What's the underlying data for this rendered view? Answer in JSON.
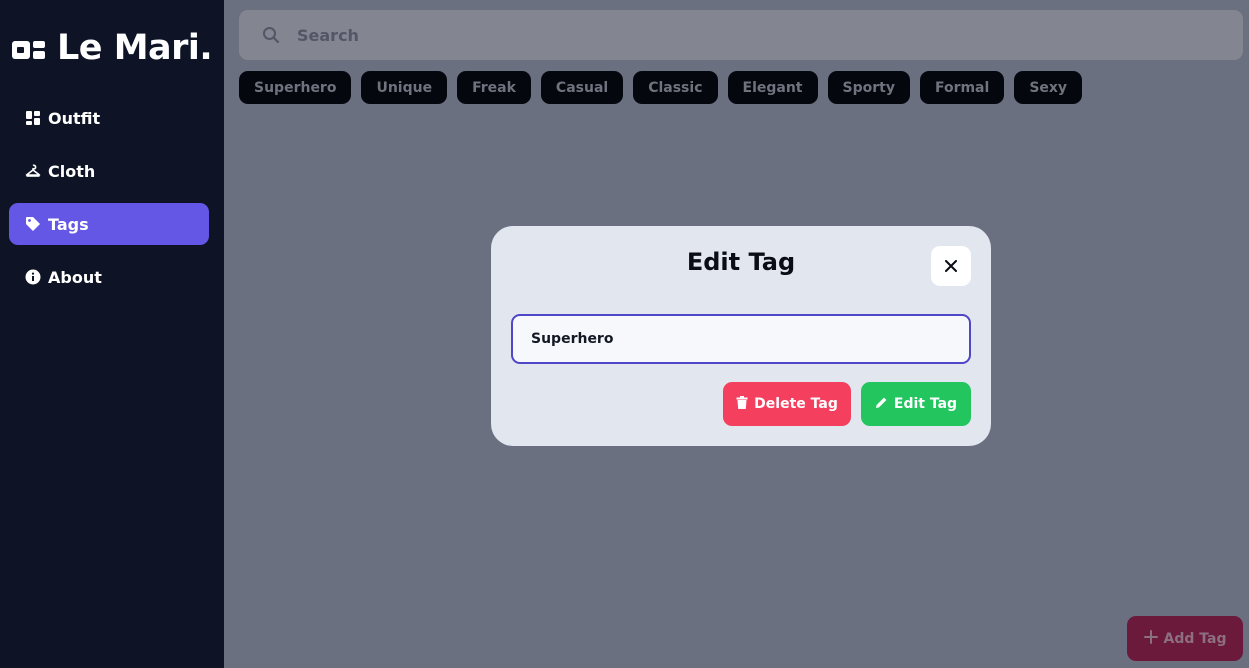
{
  "app": {
    "logo_text": "Le Mari."
  },
  "sidebar": {
    "items": [
      {
        "label": "Outfit",
        "icon": "dashboard-icon",
        "active": false
      },
      {
        "label": "Cloth",
        "icon": "hanger-icon",
        "active": false
      },
      {
        "label": "Tags",
        "icon": "tag-icon",
        "active": true
      },
      {
        "label": "About",
        "icon": "info-icon",
        "active": false
      }
    ]
  },
  "search": {
    "placeholder": "Search",
    "value": ""
  },
  "tags": [
    "Superhero",
    "Unique",
    "Freak",
    "Casual",
    "Classic",
    "Elegant",
    "Sporty",
    "Formal",
    "Sexy"
  ],
  "add_tag": {
    "label": "Add Tag",
    "icon": "plus-icon"
  },
  "modal": {
    "title": "Edit Tag",
    "close_icon": "close-icon",
    "input_value": "Superhero",
    "delete_label": "Delete Tag",
    "edit_label": "Edit Tag"
  },
  "colors": {
    "sidebar_bg": "#0e1426",
    "accent": "#6457e6",
    "overlay_bg": "#6b7080",
    "chip_bg": "#05070f",
    "delete": "#f43f5e",
    "edit": "#22c55e",
    "modal_bg": "#e1e6ef"
  }
}
